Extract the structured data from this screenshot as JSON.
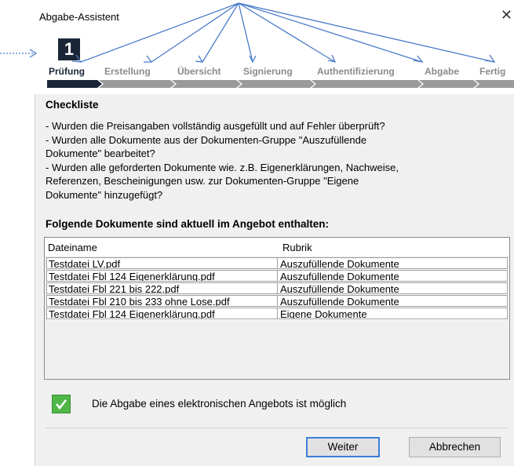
{
  "window": {
    "title": "Abgabe-Assistent",
    "close_glyph": "✕"
  },
  "wizard": {
    "current_step": "1",
    "steps": [
      "Prüfung",
      "Erstellung",
      "Übersicht",
      "Signierung",
      "Authentifizierung",
      "Abgabe",
      "Fertig"
    ],
    "active_index": 0,
    "colors": {
      "active": "#1a2638",
      "inactive": "#8a8a8a",
      "annotation": "#4a7cc9"
    }
  },
  "checklist": {
    "heading": "Checkliste",
    "lines": [
      "- Wurden die Preisangaben vollständig ausgefüllt und auf Fehler überprüft?",
      "- Wurden alle Dokumente aus der Dokumenten-Gruppe \"Auszufüllende",
      "Dokumente\" bearbeitet?",
      "- Wurden alle geforderten Dokumente wie. z.B. Eigenerklärungen, Nachweise,",
      "Referenzen, Bescheinigungen usw. zur Dokumenten-Gruppe \"Eigene",
      "Dokumente\" hinzugefügt?"
    ]
  },
  "documents": {
    "heading": "Folgende Dokumente sind aktuell im Angebot enthalten:",
    "columns": [
      "Dateiname",
      "Rubrik"
    ],
    "rows": [
      [
        "Testdatei LV.pdf",
        "Auszufüllende Dokumente"
      ],
      [
        "Testdatei Fbl 124 Eigenerklärung.pdf",
        "Auszufüllende Dokumente"
      ],
      [
        "Testdatei Fbl 221 bis 222.pdf",
        "Auszufüllende Dokumente"
      ],
      [
        "Testdatei Fbl 210 bis 233 ohne Lose.pdf",
        "Auszufüllende Dokumente"
      ],
      [
        "Testdatei Fbl 124 Eigenerklärung.pdf",
        "Eigene Dokumente"
      ]
    ]
  },
  "status": {
    "icon": "check-icon",
    "text": "Die Abgabe eines elektronischen Angebots ist möglich",
    "color": "#4fb748"
  },
  "buttons": {
    "next": "Weiter",
    "cancel": "Abbrechen"
  }
}
